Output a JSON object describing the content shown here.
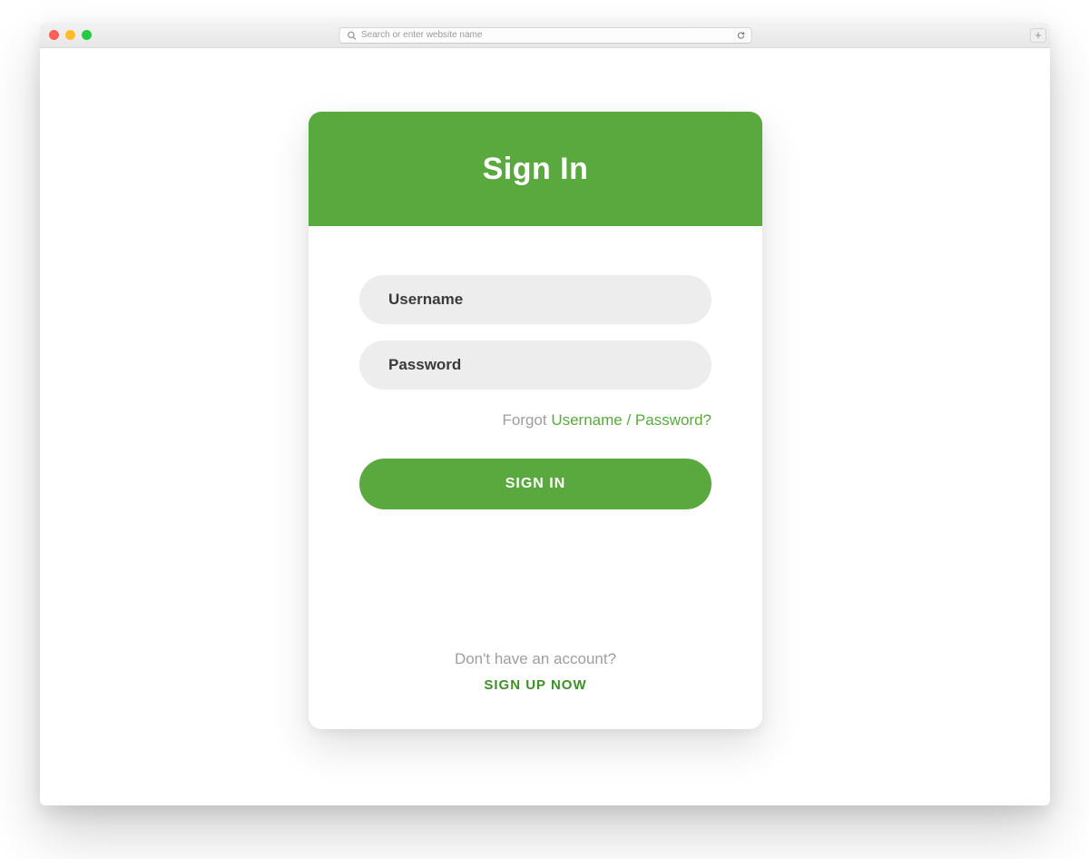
{
  "browser": {
    "address_placeholder": "Search or enter website name"
  },
  "colors": {
    "accent": "#59a93f",
    "field_bg": "#ededed",
    "muted_text": "#9e9e9e"
  },
  "card": {
    "title": "Sign In",
    "username_placeholder": "Username",
    "password_placeholder": "Password",
    "forgot_prefix": "Forgot ",
    "forgot_link": "Username / Password?",
    "signin_button": "SIGN IN",
    "no_account_text": "Don't have an account?",
    "signup_link": "SIGN UP NOW"
  }
}
